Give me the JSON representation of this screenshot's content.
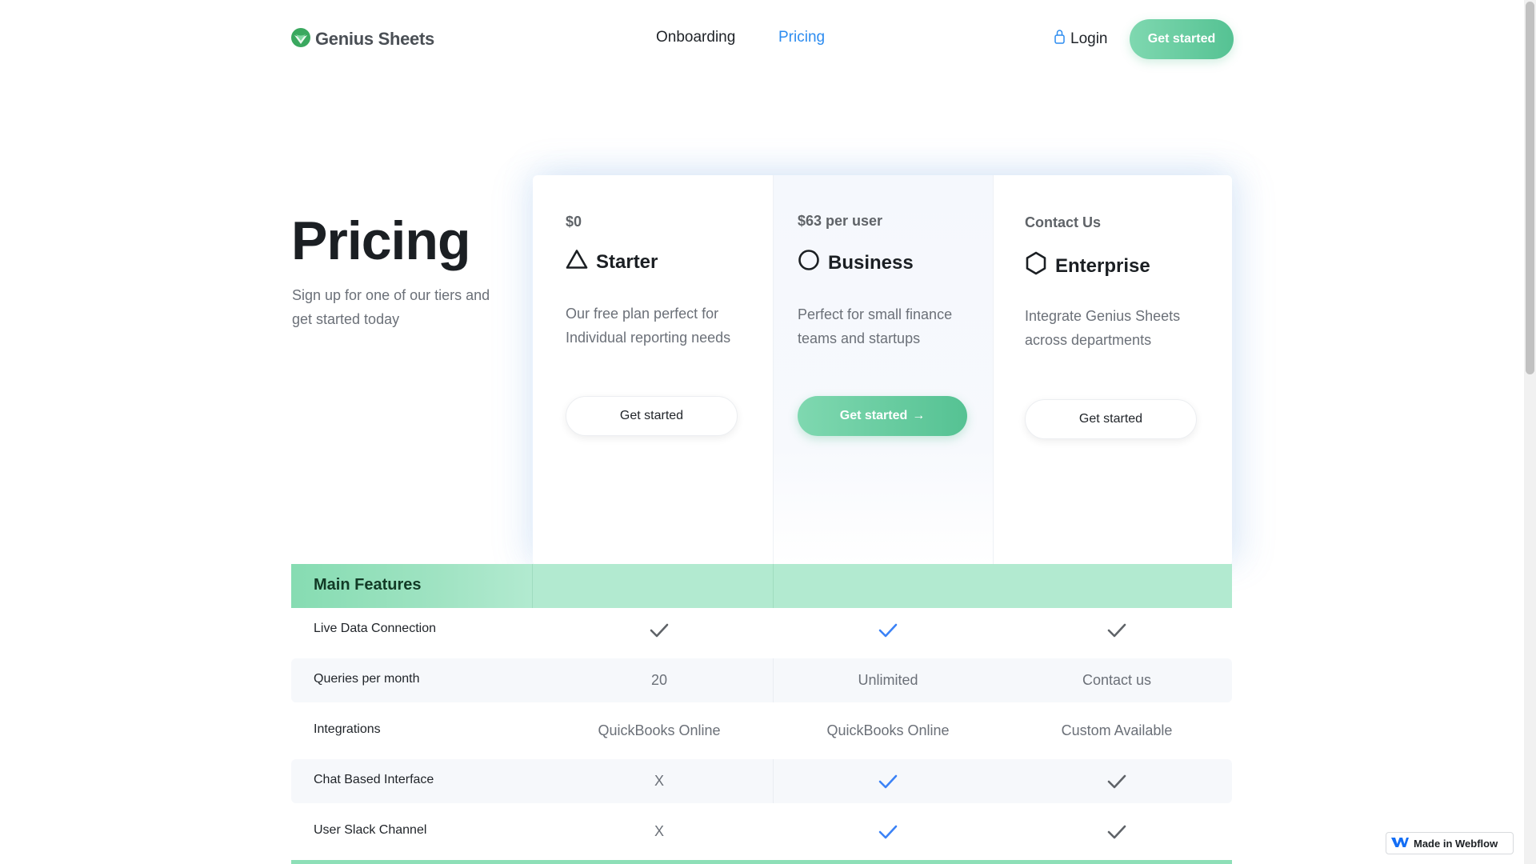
{
  "header": {
    "logo_text": "Genius Sheets",
    "nav": [
      "Onboarding",
      "Pricing"
    ],
    "login_label": "Login",
    "cta_label": "Get started"
  },
  "hero": {
    "title": "Pricing",
    "subtitle": "Sign up for one of our tiers and get started today"
  },
  "plans": [
    {
      "price": "$0",
      "name": "Starter",
      "icon": "triangle-icon",
      "description": "Our free plan perfect for Individual reporting needs",
      "button": "Get started"
    },
    {
      "price": "$63 per user",
      "name": "Business",
      "icon": "circle-icon",
      "description": "Perfect for small finance teams and startups",
      "button": "Get started"
    },
    {
      "price": "Contact Us",
      "name": "Enterprise",
      "icon": "hexagon-icon",
      "description": "Integrate Genius Sheets across departments",
      "button": "Get started"
    }
  ],
  "features": {
    "section_label": "Main Features",
    "rows": [
      {
        "name": "Live Data Connection",
        "values": [
          "check",
          "check",
          "check"
        ]
      },
      {
        "name": "Queries per month",
        "values": [
          "20",
          "Unlimited",
          "Contact us"
        ]
      },
      {
        "name": "Integrations",
        "values": [
          "QuickBooks Online",
          "QuickBooks Online",
          "Custom Available"
        ]
      },
      {
        "name": "Chat Based Interface",
        "values": [
          "X",
          "check",
          "check"
        ]
      },
      {
        "name": "User Slack Channel",
        "values": [
          "X",
          "check",
          "check"
        ]
      }
    ]
  },
  "badge": {
    "label": "Made in Webflow"
  },
  "colors": {
    "accent_green": "#55c293",
    "accent_blue": "#2c8cf0",
    "check_blue": "#3b82f6",
    "check_gray": "#5f6368"
  }
}
